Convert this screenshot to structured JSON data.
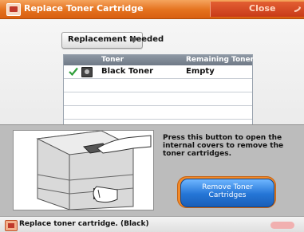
{
  "window": {
    "title": "Replace Toner Cartridge",
    "close_label": "Close"
  },
  "filter": {
    "selected": "Replacement Needed"
  },
  "table": {
    "headers": [
      "Toner",
      "Remaining Toner"
    ],
    "rows": [
      {
        "selected": true,
        "name": "Black Toner",
        "remaining": "Empty"
      },
      {
        "selected": false,
        "name": "",
        "remaining": ""
      },
      {
        "selected": false,
        "name": "",
        "remaining": ""
      },
      {
        "selected": false,
        "name": "",
        "remaining": ""
      },
      {
        "selected": false,
        "name": "",
        "remaining": ""
      }
    ]
  },
  "panel": {
    "instruction": "Press this button to open the internal covers to remove the toner cartridges.",
    "remove_button": {
      "line1": "Remove Toner",
      "line2": "Cartridges"
    }
  },
  "status": {
    "message": "Replace toner cartridge. (Black)"
  },
  "colors": {
    "accent": "#e4711d",
    "button_blue": "#2475d6",
    "button_ring": "#f28a2a"
  },
  "icons": [
    "warning-icon",
    "close-arrow-icon",
    "chevron-down-icon",
    "check-icon",
    "toner-icon",
    "printer-illustration"
  ]
}
